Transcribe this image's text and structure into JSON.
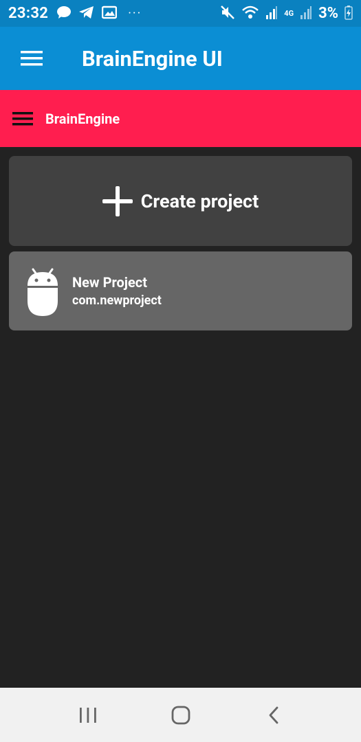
{
  "status_bar": {
    "time": "23:32",
    "left_icons": [
      "message-bubble-icon",
      "telegram-icon",
      "gallery-icon",
      "more-notifications-icon"
    ],
    "right_icons": [
      "mute-icon",
      "wifi-icon",
      "signal-icon",
      "4g-icon",
      "signal-icon-2",
      "battery-icon"
    ],
    "network_label": "4G",
    "battery_percent": "3%"
  },
  "app_bar": {
    "title": "BrainEngine UI",
    "menu_icon": "hamburger-menu-icon"
  },
  "sub_bar": {
    "title": "BrainEngine",
    "menu_icon": "hamburger-menu-icon"
  },
  "create_card": {
    "label": "Create project",
    "icon": "plus-icon"
  },
  "projects": [
    {
      "name": "New Project",
      "package": "com.newproject",
      "icon": "android-icon"
    }
  ],
  "nav_bar": {
    "buttons": [
      "recent-apps-icon",
      "home-icon",
      "back-icon"
    ]
  },
  "colors": {
    "status_bar": "#0a81c0",
    "app_bar": "#0b8ed4",
    "sub_bar": "#ff1e4f",
    "background": "#222222",
    "create_card": "#414141",
    "project_card": "#666666",
    "nav_bar": "#f1f1f1"
  }
}
